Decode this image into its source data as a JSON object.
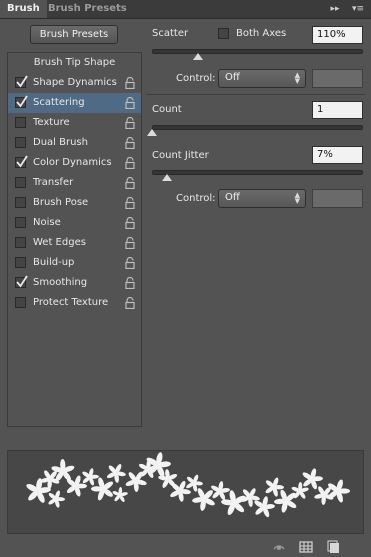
{
  "tabs": [
    {
      "label": "Brush",
      "active": true
    },
    {
      "label": "Brush Presets",
      "active": false
    }
  ],
  "tab_icons": [
    "double-arrow-icon",
    "panel-menu-icon"
  ],
  "presets_button": "Brush Presets",
  "options": {
    "header": "Brush Tip Shape",
    "items": [
      {
        "label": "Shape Dynamics",
        "checked": true,
        "selected": false
      },
      {
        "label": "Scattering",
        "checked": true,
        "selected": true
      },
      {
        "label": "Texture",
        "checked": false,
        "selected": false
      },
      {
        "label": "Dual Brush",
        "checked": false,
        "selected": false
      },
      {
        "label": "Color Dynamics",
        "checked": true,
        "selected": false
      },
      {
        "label": "Transfer",
        "checked": false,
        "selected": false
      },
      {
        "label": "Brush Pose",
        "checked": false,
        "selected": false
      },
      {
        "label": "Noise",
        "checked": false,
        "selected": false
      },
      {
        "label": "Wet Edges",
        "checked": false,
        "selected": false
      },
      {
        "label": "Build-up",
        "checked": false,
        "selected": false
      },
      {
        "label": "Smoothing",
        "checked": true,
        "selected": false
      },
      {
        "label": "Protect Texture",
        "checked": false,
        "selected": false
      }
    ]
  },
  "scatter": {
    "label": "Scatter",
    "both_axes_label": "Both Axes",
    "both_axes_checked": false,
    "value": "110%",
    "level": 0.11,
    "control_label": "Control:",
    "control_value": "Off"
  },
  "count": {
    "label": "Count",
    "value": "1",
    "level": 0.0
  },
  "count_jitter": {
    "label": "Count Jitter",
    "value": "7%",
    "level": 0.07,
    "control_label": "Control:",
    "control_value": "Off"
  },
  "bottom_icons": [
    "toggle-preview-icon",
    "grid-icon",
    "new-preset-icon"
  ],
  "colors": {
    "panel": "#535353",
    "selection": "#4f6a85",
    "field": "#f2f2f2"
  }
}
